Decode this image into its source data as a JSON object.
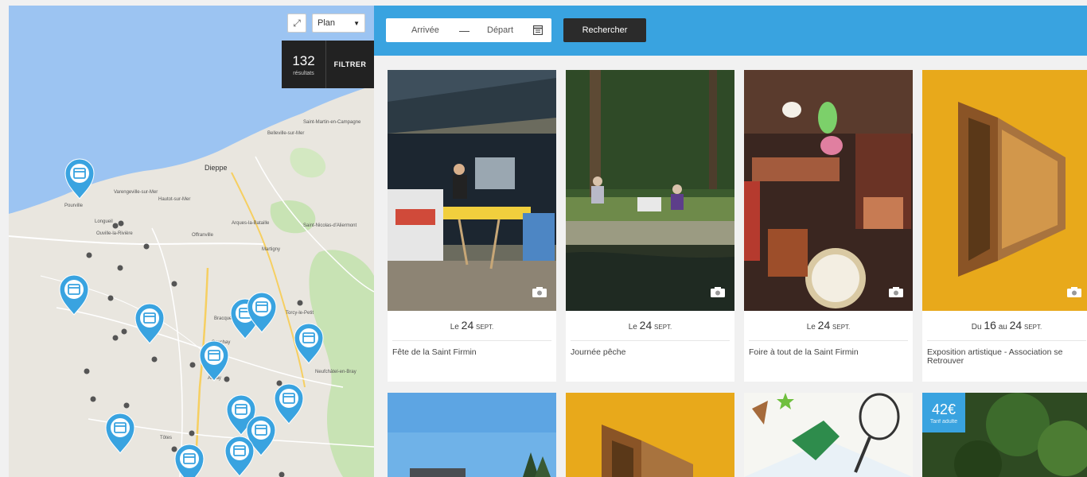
{
  "map": {
    "maptype": "Plan",
    "count": "132",
    "count_label": "résultats",
    "filter_label": "FILTRER",
    "places": [
      "Dieppe",
      "Pourville",
      "Hautot-sur-Mer",
      "Offranville",
      "Arques-la-Bataille",
      "Saint-Nicolas-d'Aliermont",
      "Auffay",
      "Tôtes",
      "Neufchâtel-en-Bray",
      "Saint-Martin-en-Campagne",
      "Belleville-sur-Mer",
      "Martigny",
      "Bracquemont",
      "Longueil",
      "Torcy-le-Petit",
      "Sauchay",
      "Varengeville-sur-Mer",
      "Ouville-la-Rivière"
    ]
  },
  "search": {
    "arrival": "Arrivée",
    "dash": "—",
    "departure": "Départ",
    "button": "Rechercher"
  },
  "cards": [
    {
      "prefix": "Le",
      "day": "24",
      "month": "SEPT.",
      "title": "Fête de la Saint Firmin"
    },
    {
      "prefix": "Le",
      "day": "24",
      "month": "SEPT.",
      "title": "Journée pêche"
    },
    {
      "prefix": "Le",
      "day": "24",
      "month": "SEPT.",
      "title": "Foire à tout de la Saint Firmin"
    },
    {
      "prefix": "Du",
      "day": "16",
      "middle": "au",
      "day2": "24",
      "month": "SEPT.",
      "title": "Exposition artistique - Association se Retrouver"
    }
  ],
  "row2": {
    "price": "42€",
    "price_label": "Tarif adulte"
  },
  "colors": {
    "accent": "#39a3e0",
    "dark": "#2b2b2b",
    "water": "#9cc4f2"
  }
}
